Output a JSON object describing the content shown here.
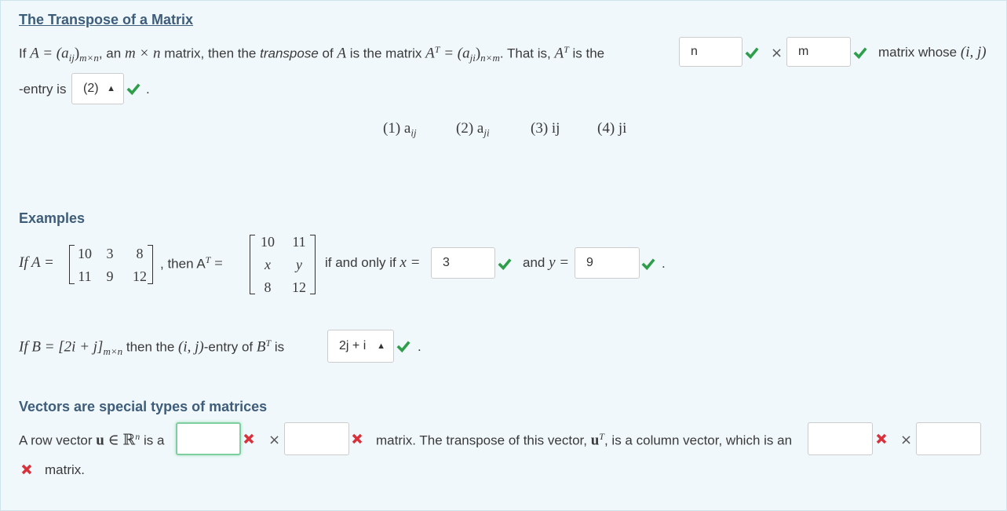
{
  "title": "The Transpose of a Matrix",
  "intro": {
    "if": "If",
    "A_def": "A = (a",
    "ij": "ij",
    "rest1": ")",
    "mxn": "m×n",
    "comma_an": ", an",
    "m_times_n": "m × n",
    "matrix_then": "matrix, then the",
    "transpose_word": "transpose",
    "of": "of",
    "A": "A",
    "is_the_matrix": "is the matrix",
    "AT_eq": "A",
    "T": "T",
    "eq_aji": "= (a",
    "ji": "ji",
    "close": ")",
    "nxm": "n×m",
    "dot_that_is": ". That is,",
    "is_the": "is the",
    "n_value": "n",
    "m_value": "m",
    "matrix_whose": "matrix whose",
    "ij_pair": "(i, j)",
    "entry_is": "-entry is",
    "entry_select": "(2)",
    "period": "."
  },
  "options": {
    "opt1": "(1) a",
    "opt1_sub": "ij",
    "opt2": "(2) a",
    "opt2_sub": "ji",
    "opt3": "(3) ij",
    "opt4": "(4) ji"
  },
  "examples": {
    "heading": "Examples",
    "if_A_eq": "If A =",
    "matrixA": [
      [
        "10",
        "3",
        "8"
      ],
      [
        "11",
        "9",
        "12"
      ]
    ],
    "then_AT": ", then A",
    "T": "T",
    "eq": "=",
    "matrixAT": [
      [
        "10",
        "11"
      ],
      [
        "x",
        "y"
      ],
      [
        "8",
        "12"
      ]
    ],
    "iff": "if and only if",
    "x_eq": "x =",
    "x_value": "3",
    "and": "and",
    "y_eq": "y =",
    "y_value": "9",
    "period": ".",
    "if_B": "If B = [2i + j]",
    "mxn": "m×n",
    "then_the": "then the",
    "ij": "(i, j)",
    "entry_of": "-entry of",
    "BT": "B",
    "T2": "T",
    "is": "is",
    "B_select": "2j + i"
  },
  "vectors": {
    "heading": "Vectors are special types of matrices",
    "row_vector_text": "A row vector",
    "u": "u",
    "in_R": "∈ ℝ",
    "n": "n",
    "is_a": "is a",
    "row_rows_value": "",
    "row_cols_value": "",
    "matrix_transpose_text": "matrix. The transpose of this vector,",
    "uT": "u",
    "T": "T",
    "column_text": ", is a column vector, which is an",
    "col_rows_value": "",
    "col_cols_value": "",
    "matrix_end": "matrix."
  },
  "colors": {
    "correct": "#2e9e4a",
    "incorrect": "#d9303a",
    "heading": "#3e5d7a"
  },
  "icons": {
    "correct": "check-icon",
    "incorrect": "x-mark-icon",
    "select_arrows": "up-down-arrows-icon"
  }
}
